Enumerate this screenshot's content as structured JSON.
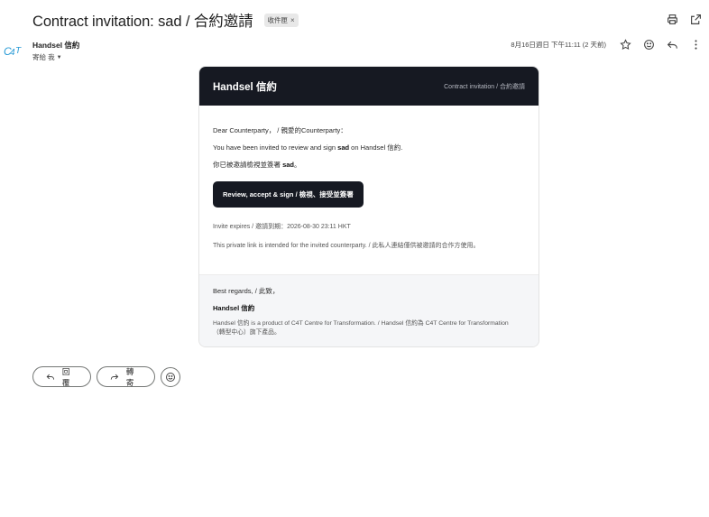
{
  "email": {
    "subject": "Contract invitation: sad / 合約邀請",
    "label": "收件匣",
    "sender_name": "Handsel 信約",
    "recipient": "寄給 我",
    "date": "8月16日週日 下午11:11 (2 天前)"
  },
  "card": {
    "brand": "Handsel 信約",
    "header_subtitle": "Contract invitation / 合約邀請",
    "greeting": "Dear Counterparty， / 親愛的Counterparty：",
    "line_en_prefix": "You have been invited to review and sign ",
    "line_en_bold": "sad",
    "line_en_suffix": " on Handsel 信約.",
    "line_zh_prefix": "你已被邀請檢視並簽署 ",
    "line_zh_bold": "sad",
    "line_zh_suffix": "。",
    "cta_label": "Review, accept & sign / 檢視、接受並簽署",
    "expires": "Invite expires / 邀請到期：2026-08-30 23:11 HKT",
    "private_note": "This private link is intended for the invited counterparty. / 此私人連結僅供被邀請的合作方使用。",
    "regards": "Best regards, / 此致，",
    "footer_brand": "Handsel 信約",
    "footer_note": "Handsel 信約 is a product of C4T Centre for Transformation. / Handsel 信約為 C4T Centre for Transformation（轉型中心）旗下產品。"
  },
  "actions": {
    "reply_label": "回覆",
    "forward_label": "轉寄"
  },
  "icons": {
    "avatar": "c4t-logo",
    "accent": "#2a9bd6",
    "dark": "#161922"
  }
}
